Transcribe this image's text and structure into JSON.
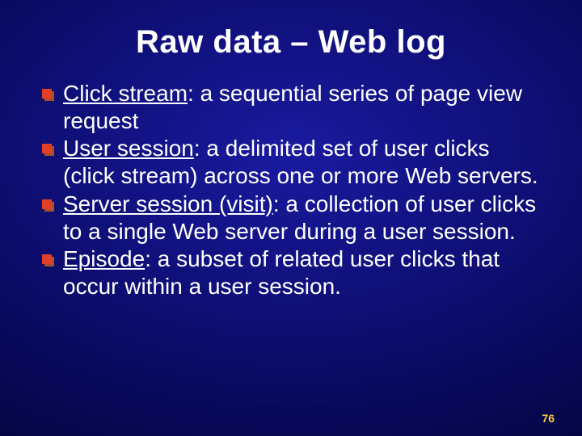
{
  "title": "Raw data – Web log",
  "items": [
    {
      "term": "Click stream",
      "rest": ": a sequential series of page view request"
    },
    {
      "term": "User session",
      "rest": ": a delimited set of user clicks (click stream) across one or more Web servers."
    },
    {
      "term": "Server session (visit)",
      "rest": ": a collection of user clicks to a single Web server during a user session."
    },
    {
      "term": "Episode",
      "rest": ": a subset of related user clicks that occur within a user session."
    }
  ],
  "page_number": "76"
}
